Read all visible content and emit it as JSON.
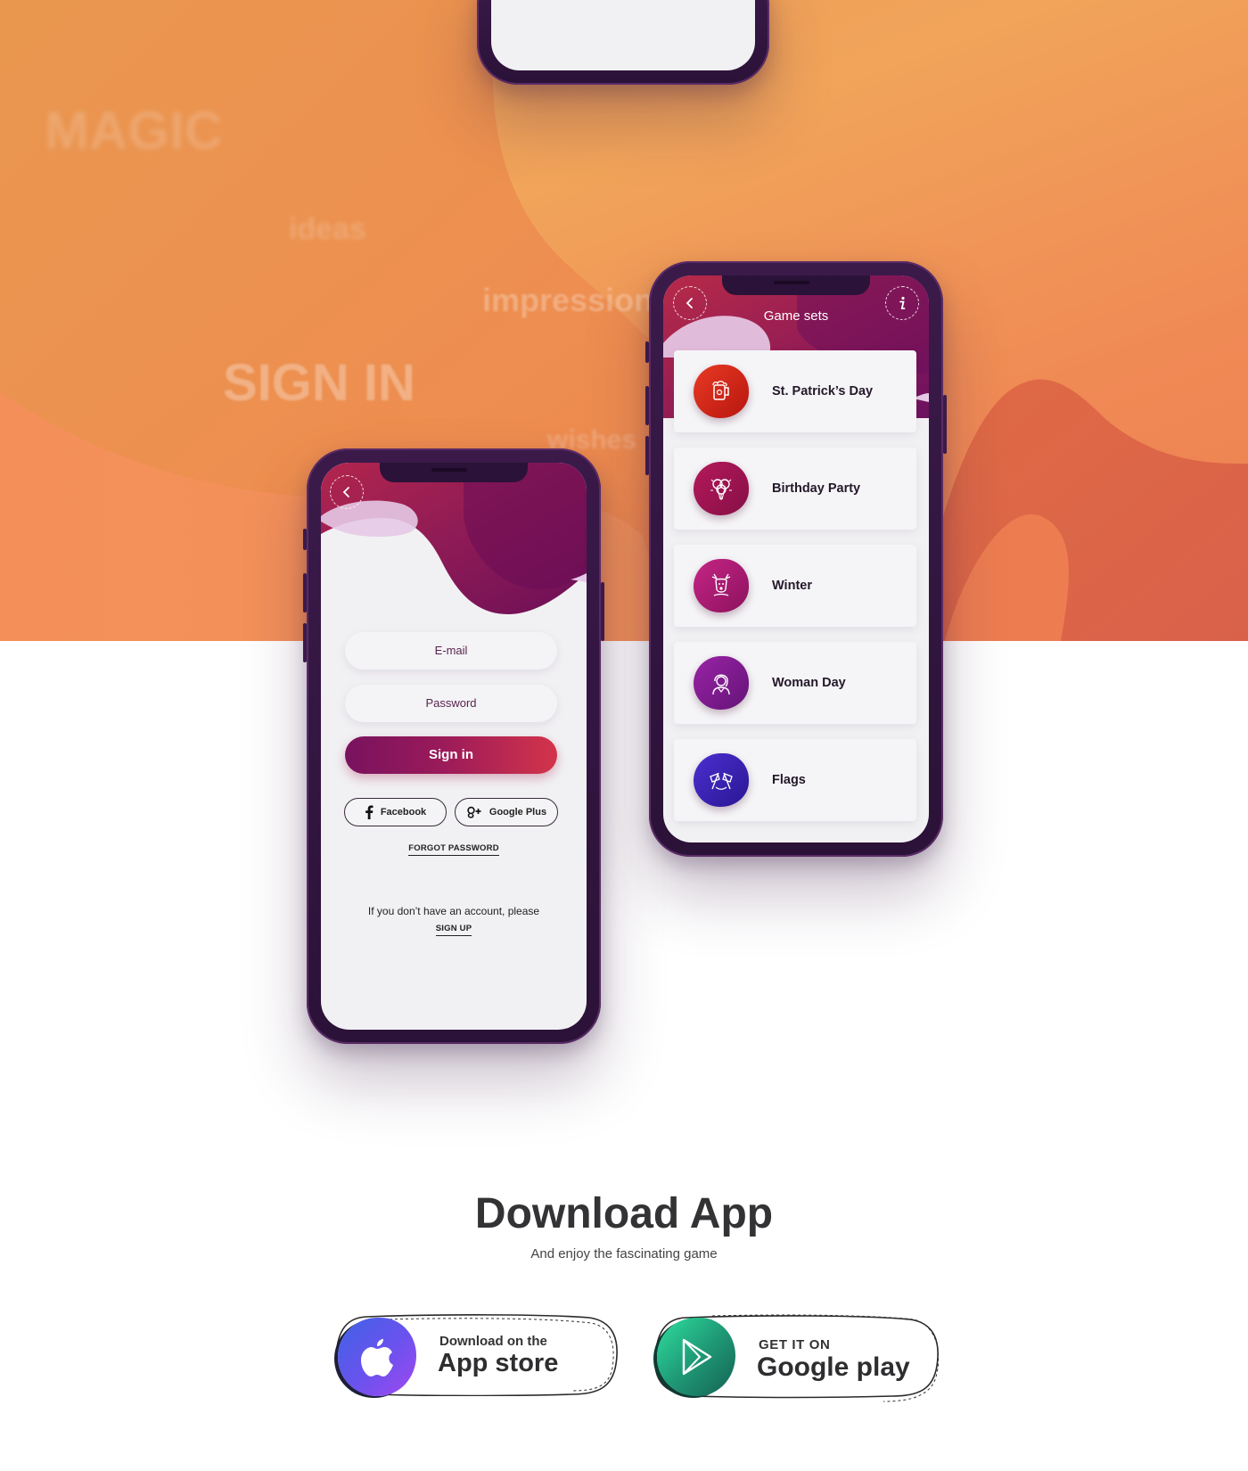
{
  "hero": {
    "background_words": [
      "MAGIC",
      "ideas",
      "impression",
      "SIGN IN",
      "wishes"
    ],
    "colors": {
      "orange_light": "#f1a45a",
      "orange": "#f08a55",
      "orange_dark": "#e46d47"
    }
  },
  "login_screen": {
    "back_icon": "chevron-left-icon",
    "email_placeholder": "E-mail",
    "password_placeholder": "Password",
    "signin_label": "Sign in",
    "facebook_label": "Facebook",
    "google_label": "Google Plus",
    "forgot_label": "FORGOT PASSWORD",
    "no_account_text": "If you don’t have an account, please",
    "signup_label": "SIGN UP",
    "accent_gradient": [
      "#78125e",
      "#d3344a"
    ]
  },
  "game_sets_screen": {
    "title": "Game sets",
    "back_icon": "chevron-left-icon",
    "info_icon": "info-icon",
    "items": [
      {
        "label": "St. Patrick’s Day",
        "icon": "beer-mug-icon",
        "color": "#d9271c"
      },
      {
        "label": "Birthday Party",
        "icon": "balloons-icon",
        "color": "#9e1450"
      },
      {
        "label": "Winter",
        "icon": "reindeer-icon",
        "color": "#b01c72"
      },
      {
        "label": "Woman Day",
        "icon": "woman-icon",
        "color": "#7f1b8c"
      },
      {
        "label": "Flags",
        "icon": "flags-icon",
        "color": "#3b1fae"
      }
    ]
  },
  "download": {
    "title": "Download App",
    "subtitle": "And enjoy the fascinating game",
    "app_store": {
      "line1": "Download on the",
      "line2": "App store",
      "icon": "apple-icon",
      "colors": [
        "#3e66e6",
        "#a248f0"
      ]
    },
    "google_play": {
      "line1": "GET IT ON",
      "line2": "Google play",
      "icon": "play-icon",
      "colors": [
        "#1b6f5e",
        "#2ee6a0"
      ]
    }
  }
}
